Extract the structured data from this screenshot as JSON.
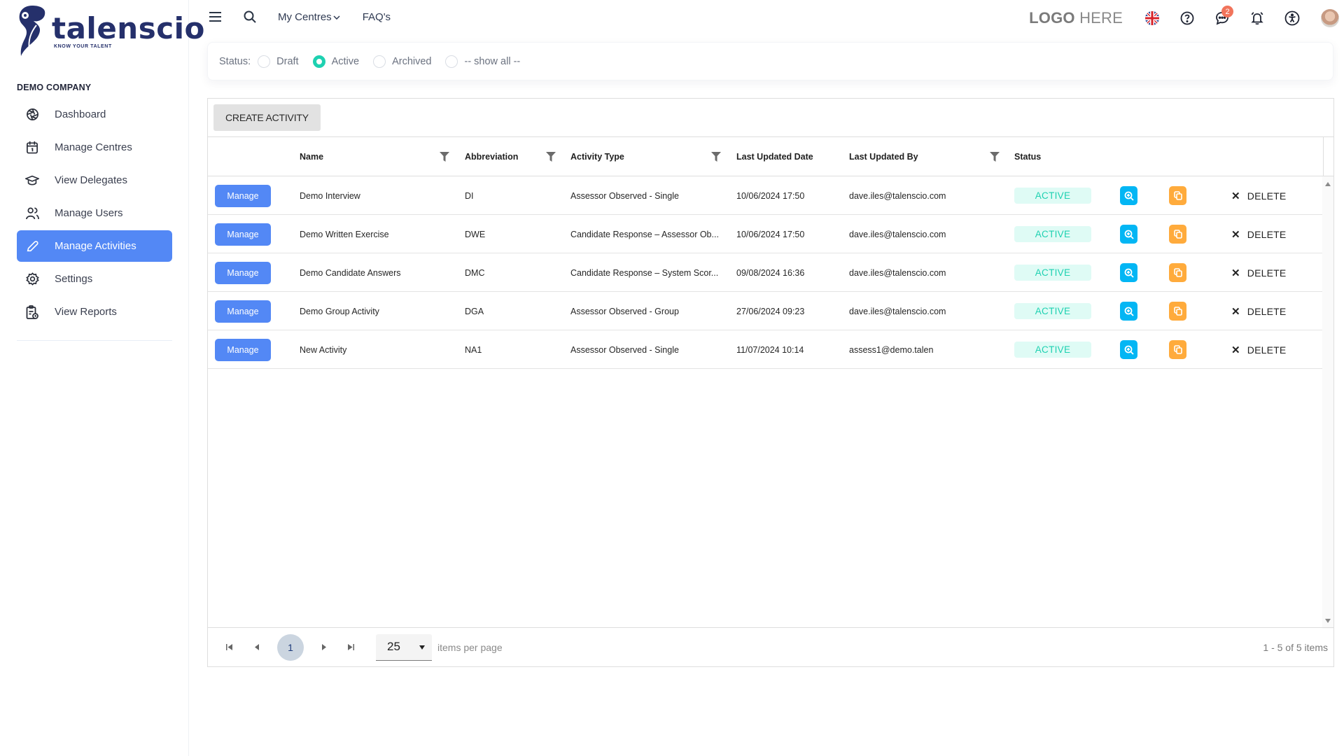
{
  "brand": {
    "name": "talenscio",
    "tagline": "KNOW YOUR TALENT",
    "primary": "#25306b",
    "accent": "#5388f5"
  },
  "sidebar": {
    "company": "DEMO COMPANY",
    "items": [
      {
        "label": "Dashboard",
        "icon": "dashboard-aperture-icon",
        "active": false
      },
      {
        "label": "Manage Centres",
        "icon": "calendar-icon",
        "active": false
      },
      {
        "label": "View Delegates",
        "icon": "graduation-cap-icon",
        "active": false
      },
      {
        "label": "Manage Users",
        "icon": "users-icon",
        "active": false
      },
      {
        "label": "Manage Activities",
        "icon": "pencil-icon",
        "active": true
      },
      {
        "label": "Settings",
        "icon": "gear-icon",
        "active": false
      },
      {
        "label": "View Reports",
        "icon": "clipboard-clock-icon",
        "active": false
      }
    ]
  },
  "topbar": {
    "my_centres": "My Centres",
    "faqs": "FAQ's",
    "logo_placeholder_bold": "LOGO",
    "logo_placeholder_light": "HERE",
    "messages_badge": "2"
  },
  "status_filter": {
    "label": "Status:",
    "options": [
      {
        "label": "Draft",
        "checked": false
      },
      {
        "label": "Active",
        "checked": true
      },
      {
        "label": "Archived",
        "checked": false
      },
      {
        "label": "-- show all --",
        "checked": false
      }
    ]
  },
  "grid": {
    "create_label": "CREATE ACTIVITY",
    "columns": {
      "name": "Name",
      "abbreviation": "Abbreviation",
      "activity_type": "Activity Type",
      "last_updated_date": "Last Updated Date",
      "last_updated_by": "Last Updated By",
      "status": "Status"
    },
    "manage_label": "Manage",
    "delete_label": "DELETE",
    "rows": [
      {
        "name": "Demo Interview",
        "abbreviation": "DI",
        "activity_type": "Assessor Observed - Single",
        "date": "10/06/2024 17:50",
        "by": "dave.iles@talenscio.com",
        "status": "ACTIVE"
      },
      {
        "name": "Demo Written Exercise",
        "abbreviation": "DWE",
        "activity_type": "Candidate Response – Assessor Ob...",
        "date": "10/06/2024 17:50",
        "by": "dave.iles@talenscio.com",
        "status": "ACTIVE"
      },
      {
        "name": "Demo Candidate Answers",
        "abbreviation": "DMC",
        "activity_type": "Candidate Response – System Scor...",
        "date": "09/08/2024 16:36",
        "by": "dave.iles@talenscio.com",
        "status": "ACTIVE"
      },
      {
        "name": "Demo Group Activity",
        "abbreviation": "DGA",
        "activity_type": "Assessor Observed - Group",
        "date": "27/06/2024 09:23",
        "by": "dave.iles@talenscio.com",
        "status": "ACTIVE"
      },
      {
        "name": "New Activity",
        "abbreviation": "NA1",
        "activity_type": "Assessor Observed - Single",
        "date": "11/07/2024 10:14",
        "by": "assess1@demo.talen",
        "status": "ACTIVE"
      }
    ],
    "pager": {
      "current_page": "1",
      "page_size": "25",
      "page_size_label": "items per page",
      "info": "1 - 5 of 5 items"
    }
  }
}
